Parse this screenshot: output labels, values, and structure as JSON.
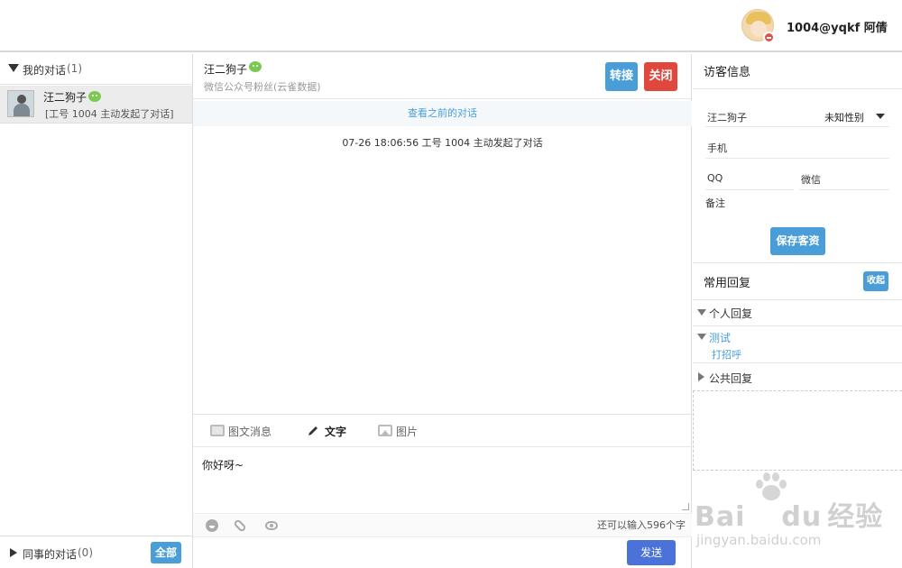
{
  "topbar": {
    "username": "1004@yqkf 阿倩",
    "caret": "⌄"
  },
  "left": {
    "my_conversations_label": "我的对话",
    "my_conversations_count": "(1)",
    "items": [
      {
        "name": "汪二狗子",
        "message": "[工号 1004 主动发起了对话]"
      }
    ],
    "colleague_conversations_label": "同事的对话",
    "colleague_conversations_count": "(0)",
    "all_button": "全部"
  },
  "chat": {
    "visitor_name": "汪二狗子",
    "visitor_source": "微信公众号粉丝(云雀数据)",
    "transfer_button": "转接",
    "close_button": "关闭",
    "history_link": "查看之前的对话",
    "system_message": "07-26 18:06:56 工号 1004 主动发起了对话",
    "tabs": [
      "图文消息",
      "文字",
      "图片"
    ],
    "active_tab": "文字",
    "input_text": "你好呀~",
    "remaining_chars": "还可以输入596个字",
    "send_button": "发送"
  },
  "visitor_info": {
    "title": "访客信息",
    "name": "汪二狗子",
    "gender": "未知性别",
    "phone_label": "手机",
    "qq_label": "QQ",
    "wechat_label": "微信",
    "note_label": "备注",
    "save_button": "保存客资"
  },
  "quick_replies": {
    "title": "常用回复",
    "fold_button": "收起",
    "personal": "个人回复",
    "test_group": "测试",
    "test_item": "打招呼",
    "public": "公共回复"
  },
  "watermark": {
    "brand": "Bai",
    "brand2": "du",
    "cn": "经验",
    "url": "jingyan.baidu.com"
  },
  "colors": {
    "primary": "#4a9ed8",
    "danger": "#e0483e",
    "send": "#4a72d8",
    "wechat": "#7bc952"
  }
}
